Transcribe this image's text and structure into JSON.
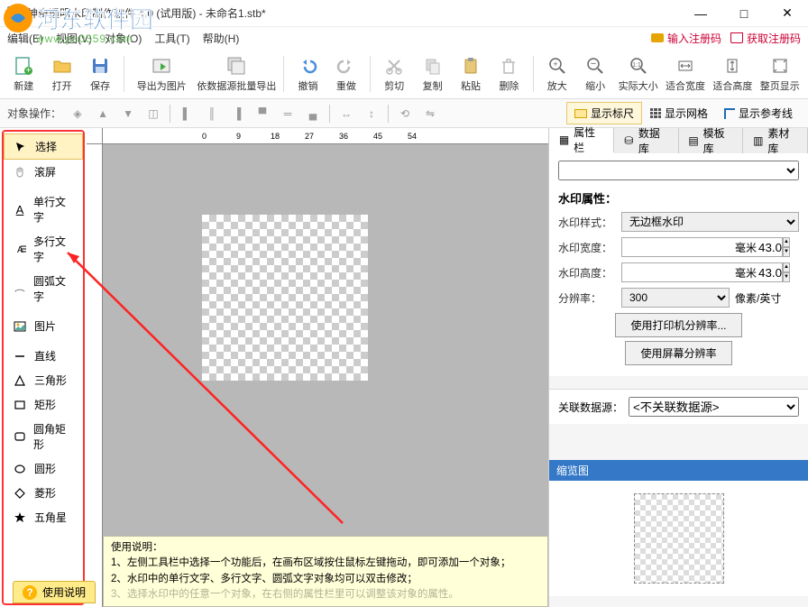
{
  "title": "神奇透明水印制作软件 4.0 (试用版) - 未命名1.stb*",
  "watermark": {
    "text": "河东软件园",
    "url": "www.pc0359.com"
  },
  "window_btns": {
    "min": "—",
    "max": "□",
    "close": "✕"
  },
  "menubar": {
    "items": [
      "编辑(E)",
      "视图(V)",
      "对象(O)",
      "工具(T)",
      "帮助(H)"
    ],
    "reg1": "输入注册码",
    "reg2": "获取注册码"
  },
  "toolbar": {
    "new": "新建",
    "open": "打开",
    "save": "保存",
    "export": "导出为图片",
    "batch": "依数据源批量导出",
    "undo": "撤销",
    "redo": "重做",
    "cut": "剪切",
    "copy": "复制",
    "paste": "粘贴",
    "delete": "删除",
    "zoomin": "放大",
    "zoomout": "缩小",
    "actual": "实际大小",
    "fitw": "适合宽度",
    "fith": "适合高度",
    "fitpage": "整页显示"
  },
  "subtoolbar": {
    "label": "对象操作：",
    "ruler": "显示标尺",
    "grid": "显示网格",
    "guide": "显示参考线"
  },
  "left_tools": {
    "select": "选择",
    "pan": "滚屏",
    "text1": "单行文字",
    "text2": "多行文字",
    "text3": "圆弧文字",
    "image": "图片",
    "line": "直线",
    "triangle": "三角形",
    "rect": "矩形",
    "roundrect": "圆角矩形",
    "circle": "圆形",
    "diamond": "菱形",
    "star": "五角星"
  },
  "ruler_ticks": [
    "0",
    "9",
    "18",
    "27",
    "36",
    "45",
    "54"
  ],
  "help_box": {
    "title": "使用说明：",
    "line1": "1、左侧工具栏中选择一个功能后，在画布区域按住鼠标左键拖动，即可添加一个对象；",
    "line2": "2、水印中的单行文字、多行文字、圆弧文字对象均可以双击修改；",
    "line3": "3、选择水印中的任意一个对象，在右侧的属性栏里可以调整该对象的属性。"
  },
  "bottom_btn": "使用说明",
  "panel": {
    "tabs": {
      "prop": "属性栏",
      "db": "数据库",
      "tpl": "模板库",
      "mat": "素材库"
    },
    "section": "水印属性：",
    "style_label": "水印样式：",
    "style_value": "无边框水印",
    "width_label": "水印宽度：",
    "width_value": "43.0",
    "width_unit": "毫米",
    "height_label": "水印高度：",
    "height_value": "43.0",
    "height_unit": "毫米",
    "dpi_label": "分辨率：",
    "dpi_value": "300",
    "dpi_unit": "像素/英寸",
    "btn1": "使用打印机分辨率...",
    "btn2": "使用屏幕分辨率",
    "ds_label": "关联数据源：",
    "ds_value": "<不关联数据源>",
    "preview_title": "缩览图"
  }
}
